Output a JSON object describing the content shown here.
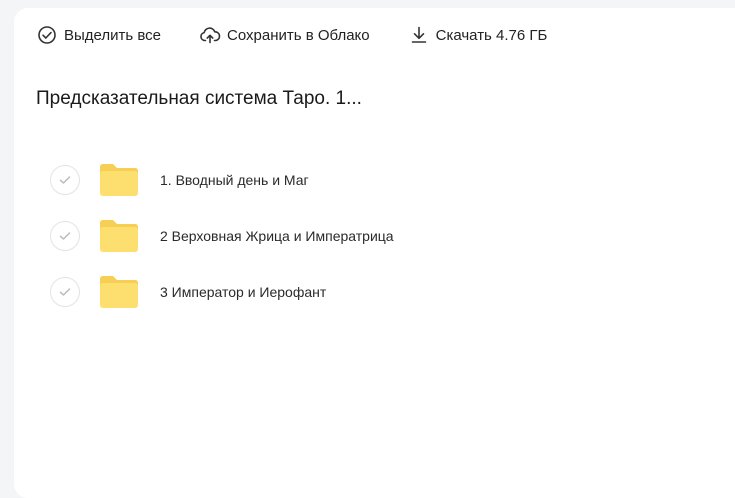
{
  "toolbar": {
    "select_all": {
      "label": "Выделить все",
      "icon": "check-circle-icon"
    },
    "save_cloud": {
      "label": "Сохранить в Облако",
      "icon": "cloud-upload-icon"
    },
    "download": {
      "label": "Скачать 4.76 ГБ",
      "icon": "download-icon"
    }
  },
  "folder": {
    "title": "Предсказательная система Таро. 1..."
  },
  "items": [
    {
      "name": "1. Вводный день и Маг",
      "icon": "folder-icon"
    },
    {
      "name": "2 Верховная Жрица и Императрица",
      "icon": "folder-icon"
    },
    {
      "name": "3 Император и Иерофант",
      "icon": "folder-icon"
    }
  ],
  "colors": {
    "folder": "#fddf70",
    "folder_tab": "#f7cf55",
    "check_border": "#e3e3e3",
    "background": "#f4f5f7",
    "panel": "#ffffff"
  }
}
